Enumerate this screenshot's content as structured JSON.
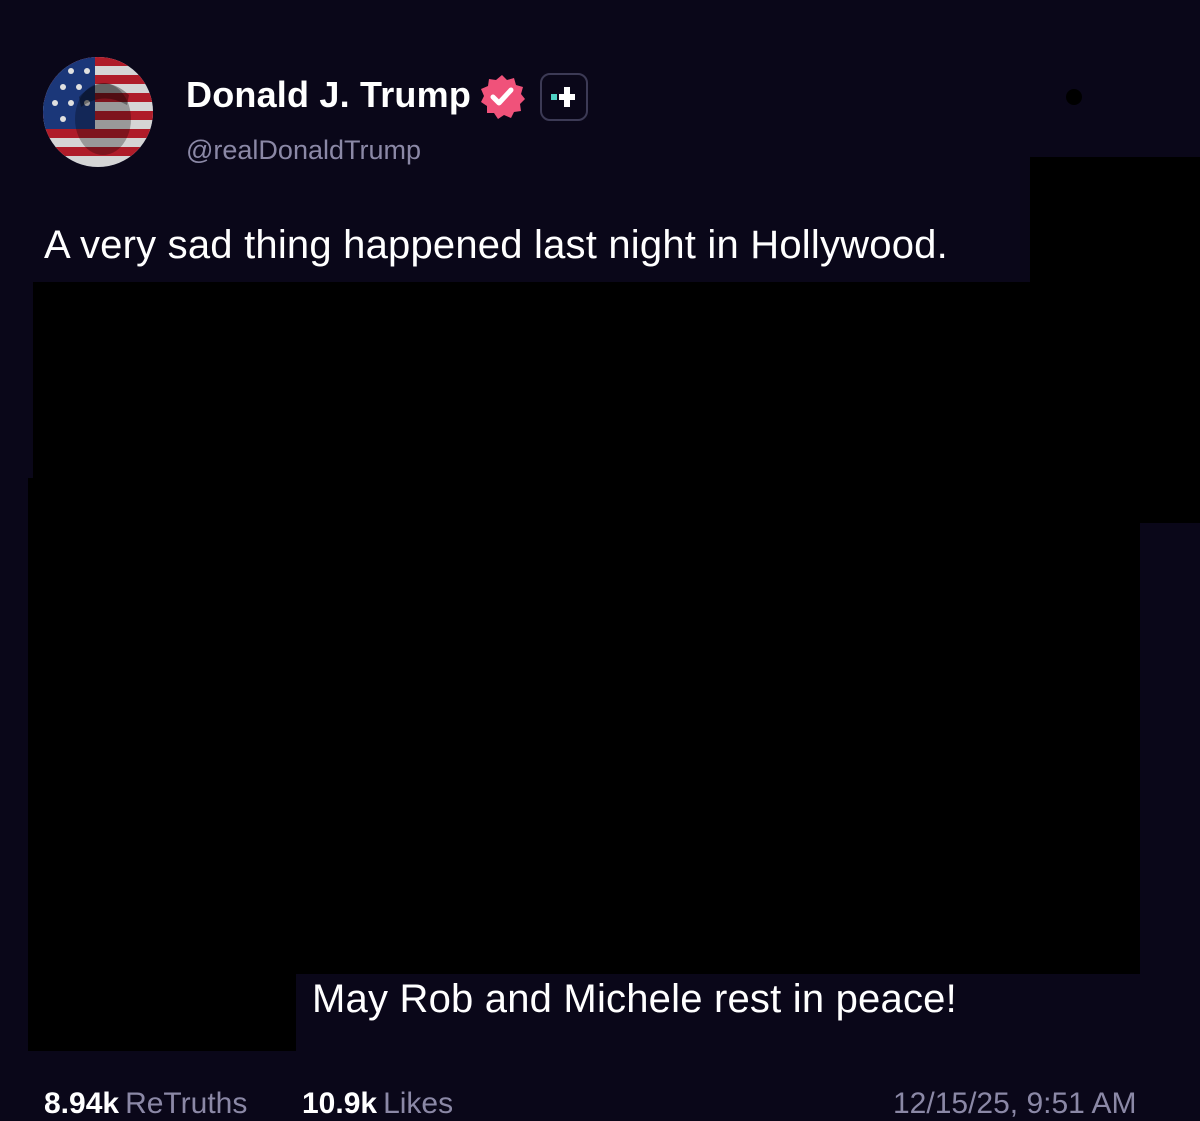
{
  "post": {
    "author": {
      "display_name": "Donald J. Trump",
      "handle": "@realDonaldTrump",
      "avatar_icon": "flag-portrait-avatar",
      "verified_icon": "verified-badge-icon",
      "plus_icon": "plus-badge-icon"
    },
    "text_line_1": "A very sad thing happened last night in Hollywood.",
    "text_line_2": "May Rob and Michele rest in peace!",
    "stats": {
      "retruths_count": "8.94k",
      "retruths_label": "ReTruths",
      "likes_count": "10.9k",
      "likes_label": "Likes",
      "timestamp": "12/15/25, 9:51 AM"
    }
  },
  "colors": {
    "background": "#0a0719",
    "text": "#ffffff",
    "muted": "#8b88a6",
    "verified": "#f0527a",
    "plus_accent": "#4fd1c5",
    "redaction": "#000000"
  }
}
